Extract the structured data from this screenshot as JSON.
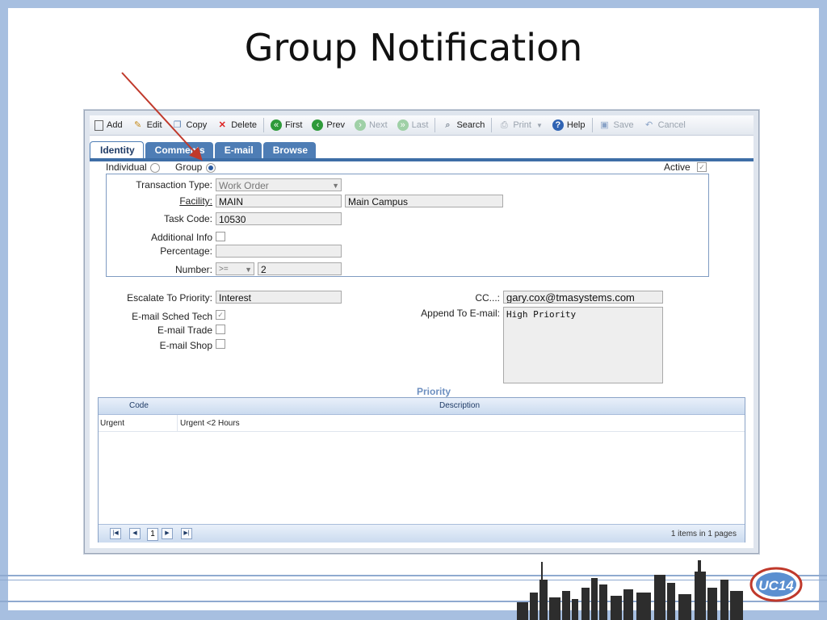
{
  "slide": {
    "title": "Group Notification"
  },
  "toolbar": {
    "add": "Add",
    "edit": "Edit",
    "copy": "Copy",
    "delete": "Delete",
    "first": "First",
    "prev": "Prev",
    "next": "Next",
    "last": "Last",
    "search": "Search",
    "print": "Print",
    "help": "Help",
    "save": "Save",
    "cancel": "Cancel"
  },
  "tabs": [
    "Identity",
    "Comments",
    "E-mail",
    "Browse"
  ],
  "type_selector": {
    "individual": "Individual",
    "group": "Group",
    "selected": "Group",
    "active_label": "Active"
  },
  "form": {
    "transaction_type_label": "Transaction Type:",
    "transaction_type_value": "Work Order",
    "facility_label": "Facility:",
    "facility_value": "MAIN",
    "facility_desc": "Main Campus",
    "task_code_label": "Task Code:",
    "task_code_value": "10530",
    "additional_info_label": "Additional Info",
    "percentage_label": "Percentage:",
    "percentage_value": "",
    "number_label": "Number:",
    "number_operator": ">=",
    "number_value": "2"
  },
  "escalation": {
    "priority_label": "Escalate To Priority:",
    "priority_value": "Interest",
    "cc_label": "CC...:",
    "cc_value": "gary.cox@tmasystems.com",
    "append_label": "Append To E-mail:",
    "append_value": "High Priority",
    "sched_tech_label": "E-mail Sched Tech",
    "trade_label": "E-mail Trade",
    "shop_label": "E-mail Shop"
  },
  "grid": {
    "title": "Priority",
    "columns": [
      "Code",
      "Description"
    ],
    "rows": [
      {
        "code": "Urgent",
        "description": "Urgent <2 Hours"
      }
    ],
    "page": "1",
    "pager_info": "1 items in 1 pages"
  },
  "brand": {
    "logo_text": "UC14",
    "accent": "#c0392b",
    "tab_color": "#4e7db5"
  }
}
